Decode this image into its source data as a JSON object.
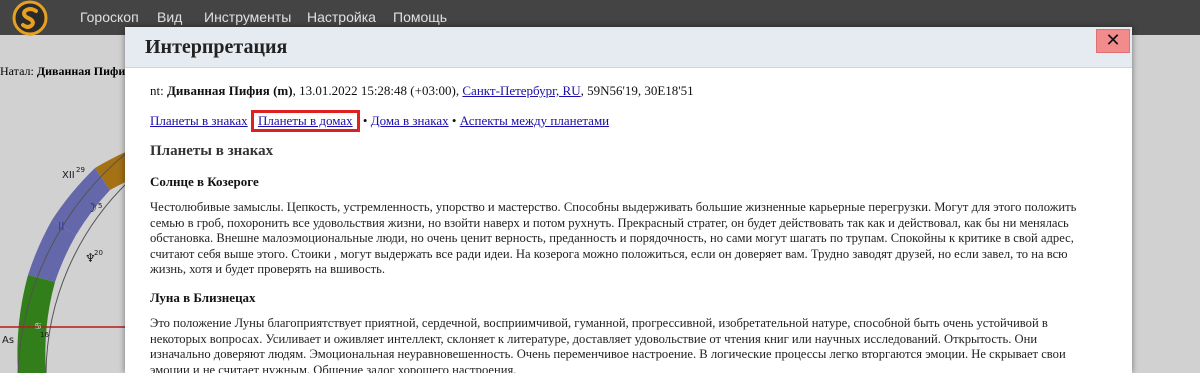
{
  "menubar": {
    "items": [
      "Гороскоп",
      "Вид",
      "Инструменты",
      "Настройка",
      "Помощь"
    ]
  },
  "background": {
    "natal_prefix": "Натал:",
    "natal_name": "Диванная Пифия",
    "wheel_labels": [
      "XII",
      "29",
      "5",
      "II",
      "20",
      "16",
      "As"
    ]
  },
  "modal": {
    "title": "Интерпретация",
    "close_symbol": "✕",
    "chart_prefix": "nt:",
    "chart_name": "Диванная Пифия (m)",
    "chart_datetime": ", 13.01.2022 15:28:48 (+03:00), ",
    "chart_place": "Санкт-Петербург, RU",
    "chart_coords": ", 59N56'19, 30E18'51",
    "nav": {
      "link1": "Планеты в знаках",
      "link2": "Планеты в домах",
      "link3": "Дома в знаках",
      "link4": "Аспекты между планетами",
      "separator": "•"
    },
    "section_title": "Планеты в знаках",
    "entries": [
      {
        "title": "Солнце в Козероге",
        "text": "Честолюбивые замыслы. Цепкость, устремленность, упорство и мастерство. Способны выдерживать большие жизненные карьерные перегрузки. Могут для этого положить семью в гроб, похоронить все удовольствия жизни, но взойти наверх и потом рухнуть. Прекрасный стратег, он будет действовать так как и действовал, как бы ни менялась обстановка. Внешне малоэмоциональные люди, но очень ценит верность, преданность и порядочность, но сами могут шагать по трупам. Спокойны к критике в свой адрес, считают себя выше этого. Стоики , могут выдержать все ради идеи. На козерога можно положиться, если он доверяет вам. Трудно заводят друзей, но если завел, то на всю жизнь, хотя и будет проверять на вшивость."
      },
      {
        "title": "Луна в Близнецах",
        "text": "Это положение Луны благоприятствует приятной, сердечной, восприимчивой, гуманной, прогрессивной, изобретательной натуре, способной быть очень устойчивой в некоторых вопросах. Усиливает и оживляет интеллект, склоняет к литературе, доставляет удовольствие от чтения книг или научных исследований. Открытость. Они изначально доверяют людям. Эмоциональная неуравновешенность. Очень переменчивое настроение. В логические процессы легко вторгаются эмоции. Не скрывает свои эмоции и не считает нужным. Общение залог хорошего настроения."
      }
    ]
  },
  "colors": {
    "menubar": "#444444",
    "header": "#e6eaf1",
    "close": "#f28c8c",
    "link": "#1a0dab",
    "highlight": "#e02020"
  }
}
